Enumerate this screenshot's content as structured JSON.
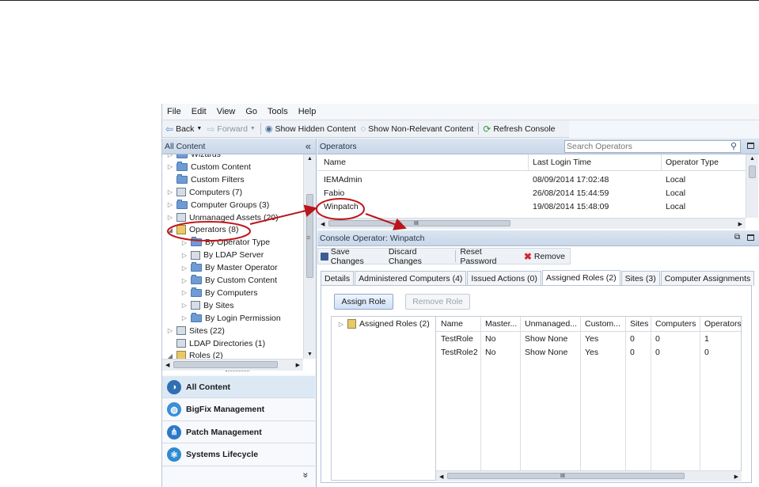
{
  "menu": [
    "File",
    "Edit",
    "View",
    "Go",
    "Tools",
    "Help"
  ],
  "toolbar": {
    "back": "Back",
    "forward": "Forward",
    "show_hidden": "Show Hidden Content",
    "show_non_relevant": "Show Non-Relevant Content",
    "refresh": "Refresh Console"
  },
  "left_panel": {
    "title": "All Content",
    "collapse": "«",
    "tree": [
      {
        "label": "Wizards",
        "indent": 0,
        "expander": "▷"
      },
      {
        "label": "Custom Content",
        "indent": 0,
        "expander": "▷"
      },
      {
        "label": "Custom Filters",
        "indent": 0,
        "expander": ""
      },
      {
        "label": "Computers (7)",
        "indent": 0,
        "expander": "▷"
      },
      {
        "label": "Computer Groups (3)",
        "indent": 0,
        "expander": "▷"
      },
      {
        "label": "Unmanaged Assets (20)",
        "indent": 0,
        "expander": "▷"
      },
      {
        "label": "Operators (8)",
        "indent": 0,
        "expander": "◢"
      },
      {
        "label": "By Operator Type",
        "indent": 1,
        "expander": "▷"
      },
      {
        "label": "By LDAP Server",
        "indent": 1,
        "expander": "▷"
      },
      {
        "label": "By Master Operator",
        "indent": 1,
        "expander": "▷"
      },
      {
        "label": "By Custom Content",
        "indent": 1,
        "expander": "▷"
      },
      {
        "label": "By Computers",
        "indent": 1,
        "expander": "▷"
      },
      {
        "label": "By Sites",
        "indent": 1,
        "expander": "▷"
      },
      {
        "label": "By Login Permission",
        "indent": 1,
        "expander": "▷"
      },
      {
        "label": "Sites (22)",
        "indent": 0,
        "expander": "▷"
      },
      {
        "label": "LDAP Directories (1)",
        "indent": 0,
        "expander": ""
      },
      {
        "label": "Roles (2)",
        "indent": 0,
        "expander": "◢"
      }
    ],
    "nav": [
      {
        "label": "All Content",
        "icon": "all-content-icon",
        "color": "#2f6fb3"
      },
      {
        "label": "BigFix Management",
        "icon": "globe-icon",
        "color": "#3a8ed6"
      },
      {
        "label": "Patch Management",
        "icon": "network-icon",
        "color": "#2b79c7"
      },
      {
        "label": "Systems Lifecycle",
        "icon": "atom-icon",
        "color": "#2e8bd0"
      }
    ],
    "nav_more": "»"
  },
  "operators": {
    "title": "Operators",
    "search_placeholder": "Search Operators",
    "columns": [
      "Name",
      "Last Login Time",
      "Operator Type"
    ],
    "rows": [
      [
        "IEMAdmin",
        "08/09/2014 17:02:48",
        "Local"
      ],
      [
        "Fabio",
        "26/08/2014 15:44:59",
        "Local"
      ],
      [
        "Winpatch",
        "19/08/2014 15:48:09",
        "Local"
      ]
    ],
    "scroll_grip": "III"
  },
  "detail": {
    "title": "Console Operator: Winpatch",
    "save": "Save Changes",
    "discard": "Discard Changes",
    "reset": "Reset Password",
    "remove": "Remove",
    "tabs": [
      "Details",
      "Administered Computers (4)",
      "Issued Actions (0)",
      "Assigned Roles (2)",
      "Sites (3)",
      "Computer Assignments"
    ],
    "assign_role": "Assign Role",
    "remove_role": "Remove Role",
    "roles_node": "Assigned Roles (2)",
    "role_columns": [
      "Name",
      "Master...",
      "Unmanaged...",
      "Custom...",
      "Sites",
      "Computers",
      "Operators"
    ],
    "role_rows": [
      [
        "TestRole",
        "No",
        "Show None",
        "Yes",
        "0",
        "0",
        "1"
      ],
      [
        "TestRole2",
        "No",
        "Show None",
        "Yes",
        "0",
        "0",
        "0"
      ]
    ],
    "scroll_grip": "III"
  },
  "colors": {
    "accent": "#3a6fb5",
    "annotation": "#c0171c",
    "selected_nav": "#dde8f5"
  }
}
